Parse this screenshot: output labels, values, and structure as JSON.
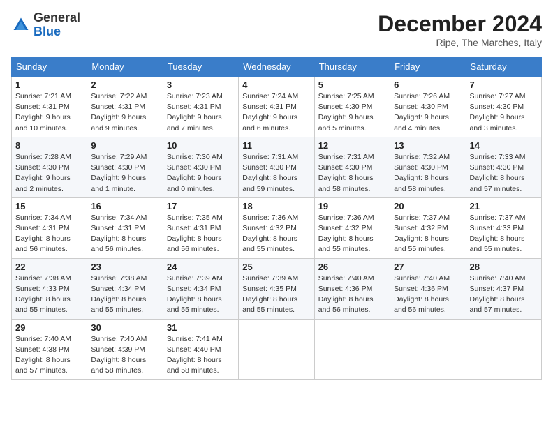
{
  "header": {
    "logo_general": "General",
    "logo_blue": "Blue",
    "month_title": "December 2024",
    "location": "Ripe, The Marches, Italy"
  },
  "weekdays": [
    "Sunday",
    "Monday",
    "Tuesday",
    "Wednesday",
    "Thursday",
    "Friday",
    "Saturday"
  ],
  "weeks": [
    [
      {
        "day": "1",
        "sunrise": "7:21 AM",
        "sunset": "4:31 PM",
        "daylight": "9 hours and 10 minutes."
      },
      {
        "day": "2",
        "sunrise": "7:22 AM",
        "sunset": "4:31 PM",
        "daylight": "9 hours and 9 minutes."
      },
      {
        "day": "3",
        "sunrise": "7:23 AM",
        "sunset": "4:31 PM",
        "daylight": "9 hours and 7 minutes."
      },
      {
        "day": "4",
        "sunrise": "7:24 AM",
        "sunset": "4:31 PM",
        "daylight": "9 hours and 6 minutes."
      },
      {
        "day": "5",
        "sunrise": "7:25 AM",
        "sunset": "4:30 PM",
        "daylight": "9 hours and 5 minutes."
      },
      {
        "day": "6",
        "sunrise": "7:26 AM",
        "sunset": "4:30 PM",
        "daylight": "9 hours and 4 minutes."
      },
      {
        "day": "7",
        "sunrise": "7:27 AM",
        "sunset": "4:30 PM",
        "daylight": "9 hours and 3 minutes."
      }
    ],
    [
      {
        "day": "8",
        "sunrise": "7:28 AM",
        "sunset": "4:30 PM",
        "daylight": "9 hours and 2 minutes."
      },
      {
        "day": "9",
        "sunrise": "7:29 AM",
        "sunset": "4:30 PM",
        "daylight": "9 hours and 1 minute."
      },
      {
        "day": "10",
        "sunrise": "7:30 AM",
        "sunset": "4:30 PM",
        "daylight": "9 hours and 0 minutes."
      },
      {
        "day": "11",
        "sunrise": "7:31 AM",
        "sunset": "4:30 PM",
        "daylight": "8 hours and 59 minutes."
      },
      {
        "day": "12",
        "sunrise": "7:31 AM",
        "sunset": "4:30 PM",
        "daylight": "8 hours and 58 minutes."
      },
      {
        "day": "13",
        "sunrise": "7:32 AM",
        "sunset": "4:30 PM",
        "daylight": "8 hours and 58 minutes."
      },
      {
        "day": "14",
        "sunrise": "7:33 AM",
        "sunset": "4:30 PM",
        "daylight": "8 hours and 57 minutes."
      }
    ],
    [
      {
        "day": "15",
        "sunrise": "7:34 AM",
        "sunset": "4:31 PM",
        "daylight": "8 hours and 56 minutes."
      },
      {
        "day": "16",
        "sunrise": "7:34 AM",
        "sunset": "4:31 PM",
        "daylight": "8 hours and 56 minutes."
      },
      {
        "day": "17",
        "sunrise": "7:35 AM",
        "sunset": "4:31 PM",
        "daylight": "8 hours and 56 minutes."
      },
      {
        "day": "18",
        "sunrise": "7:36 AM",
        "sunset": "4:32 PM",
        "daylight": "8 hours and 55 minutes."
      },
      {
        "day": "19",
        "sunrise": "7:36 AM",
        "sunset": "4:32 PM",
        "daylight": "8 hours and 55 minutes."
      },
      {
        "day": "20",
        "sunrise": "7:37 AM",
        "sunset": "4:32 PM",
        "daylight": "8 hours and 55 minutes."
      },
      {
        "day": "21",
        "sunrise": "7:37 AM",
        "sunset": "4:33 PM",
        "daylight": "8 hours and 55 minutes."
      }
    ],
    [
      {
        "day": "22",
        "sunrise": "7:38 AM",
        "sunset": "4:33 PM",
        "daylight": "8 hours and 55 minutes."
      },
      {
        "day": "23",
        "sunrise": "7:38 AM",
        "sunset": "4:34 PM",
        "daylight": "8 hours and 55 minutes."
      },
      {
        "day": "24",
        "sunrise": "7:39 AM",
        "sunset": "4:34 PM",
        "daylight": "8 hours and 55 minutes."
      },
      {
        "day": "25",
        "sunrise": "7:39 AM",
        "sunset": "4:35 PM",
        "daylight": "8 hours and 55 minutes."
      },
      {
        "day": "26",
        "sunrise": "7:40 AM",
        "sunset": "4:36 PM",
        "daylight": "8 hours and 56 minutes."
      },
      {
        "day": "27",
        "sunrise": "7:40 AM",
        "sunset": "4:36 PM",
        "daylight": "8 hours and 56 minutes."
      },
      {
        "day": "28",
        "sunrise": "7:40 AM",
        "sunset": "4:37 PM",
        "daylight": "8 hours and 57 minutes."
      }
    ],
    [
      {
        "day": "29",
        "sunrise": "7:40 AM",
        "sunset": "4:38 PM",
        "daylight": "8 hours and 57 minutes."
      },
      {
        "day": "30",
        "sunrise": "7:40 AM",
        "sunset": "4:39 PM",
        "daylight": "8 hours and 58 minutes."
      },
      {
        "day": "31",
        "sunrise": "7:41 AM",
        "sunset": "4:40 PM",
        "daylight": "8 hours and 58 minutes."
      },
      null,
      null,
      null,
      null
    ]
  ],
  "labels": {
    "sunrise": "Sunrise:",
    "sunset": "Sunset:",
    "daylight": "Daylight:"
  }
}
